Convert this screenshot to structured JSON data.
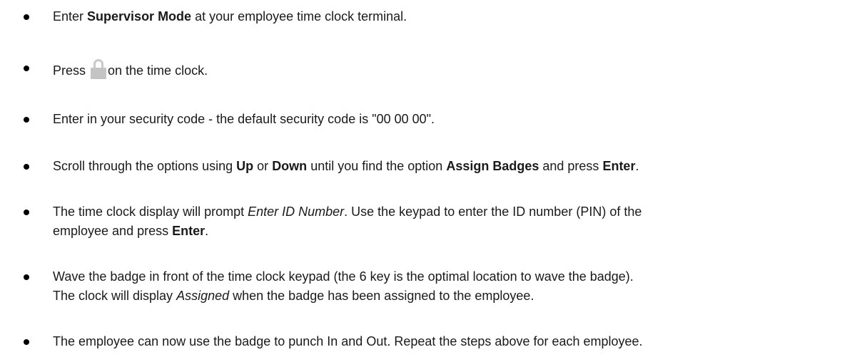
{
  "steps": [
    {
      "parts": [
        {
          "text": "Enter ",
          "style": "normal"
        },
        {
          "text": "Supervisor Mode",
          "style": "bold"
        },
        {
          "text": " at your employee time clock terminal.",
          "style": "normal"
        }
      ]
    },
    {
      "parts": [
        {
          "text": "Press ",
          "style": "normal"
        },
        {
          "icon": "lock-icon"
        },
        {
          "text": "on the time clock.",
          "style": "normal"
        }
      ]
    },
    {
      "parts": [
        {
          "text": "Enter in your security code - the default security code is \"00 00 00\".",
          "style": "normal"
        }
      ]
    },
    {
      "parts": [
        {
          "text": "Scroll through the options using ",
          "style": "normal"
        },
        {
          "text": "Up",
          "style": "bold"
        },
        {
          "text": " or ",
          "style": "normal"
        },
        {
          "text": "Down",
          "style": "bold"
        },
        {
          "text": " until you find the option ",
          "style": "normal"
        },
        {
          "text": "Assign Badges",
          "style": "bold"
        },
        {
          "text": " and press ",
          "style": "normal"
        },
        {
          "text": "Enter",
          "style": "bold"
        },
        {
          "text": ".",
          "style": "normal"
        }
      ]
    },
    {
      "parts": [
        {
          "text": "The time clock display will prompt ",
          "style": "normal"
        },
        {
          "text": "Enter ID Number",
          "style": "italic"
        },
        {
          "text": ". Use the keypad to enter the ID number (PIN) of the",
          "style": "normal"
        },
        {
          "break": true
        },
        {
          "text": "employee and press ",
          "style": "normal"
        },
        {
          "text": "Enter",
          "style": "bold"
        },
        {
          "text": ".",
          "style": "normal"
        }
      ]
    },
    {
      "parts": [
        {
          "text": "Wave the badge in front of the time clock keypad (the 6 key is the optimal location to wave the badge).",
          "style": "normal"
        },
        {
          "break": true
        },
        {
          "text": "The clock will display ",
          "style": "normal"
        },
        {
          "text": "Assigned",
          "style": "italic"
        },
        {
          "text": " when the badge has been assigned to the employee.",
          "style": "normal"
        }
      ]
    },
    {
      "parts": [
        {
          "text": "The employee can now use the badge to punch In and Out. Repeat the steps above for each employee.",
          "style": "normal"
        }
      ]
    }
  ]
}
